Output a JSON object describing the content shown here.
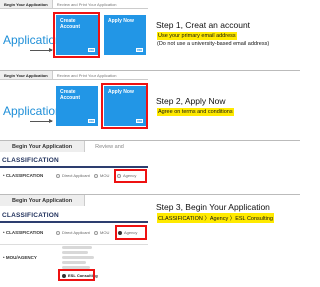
{
  "tabs": {
    "begin": "Begin Your Application",
    "review": "Review and Print Your Application"
  },
  "panel": {
    "app_title": "Application",
    "create_tile": "Create Account",
    "apply_tile": "Apply Now",
    "go_glyph": "GO"
  },
  "step1": {
    "title": "Step 1, Creat an account",
    "highlight": "Use your primary email address",
    "note": "(Do not use a university-based email address)"
  },
  "step2": {
    "title": "Step 2, Apply Now",
    "highlight": "Agree on terms and conditions"
  },
  "step3": {
    "title": "Step 3, Begin Your Application",
    "highlight": "CLASSIFICATION 〉Agency 〉ESL Consulting"
  },
  "form": {
    "begin_tab": "Begin Your Application",
    "review_tab": "Review and",
    "section_title": "CLASSIFICATION",
    "classification_label": "• CLASSIFICATION",
    "opt_direct": "Direct Applicant",
    "opt_mou": "MOU",
    "opt_agency": "Agency",
    "mou_label": "• MOU/AGENCY",
    "esl_option": "ESL Consulting"
  },
  "colors": {
    "tile_blue": "#2296e6",
    "highlight_red": "#e11111",
    "highlight_yellow": "#ffea00",
    "section_navy": "#2d3e6f"
  }
}
